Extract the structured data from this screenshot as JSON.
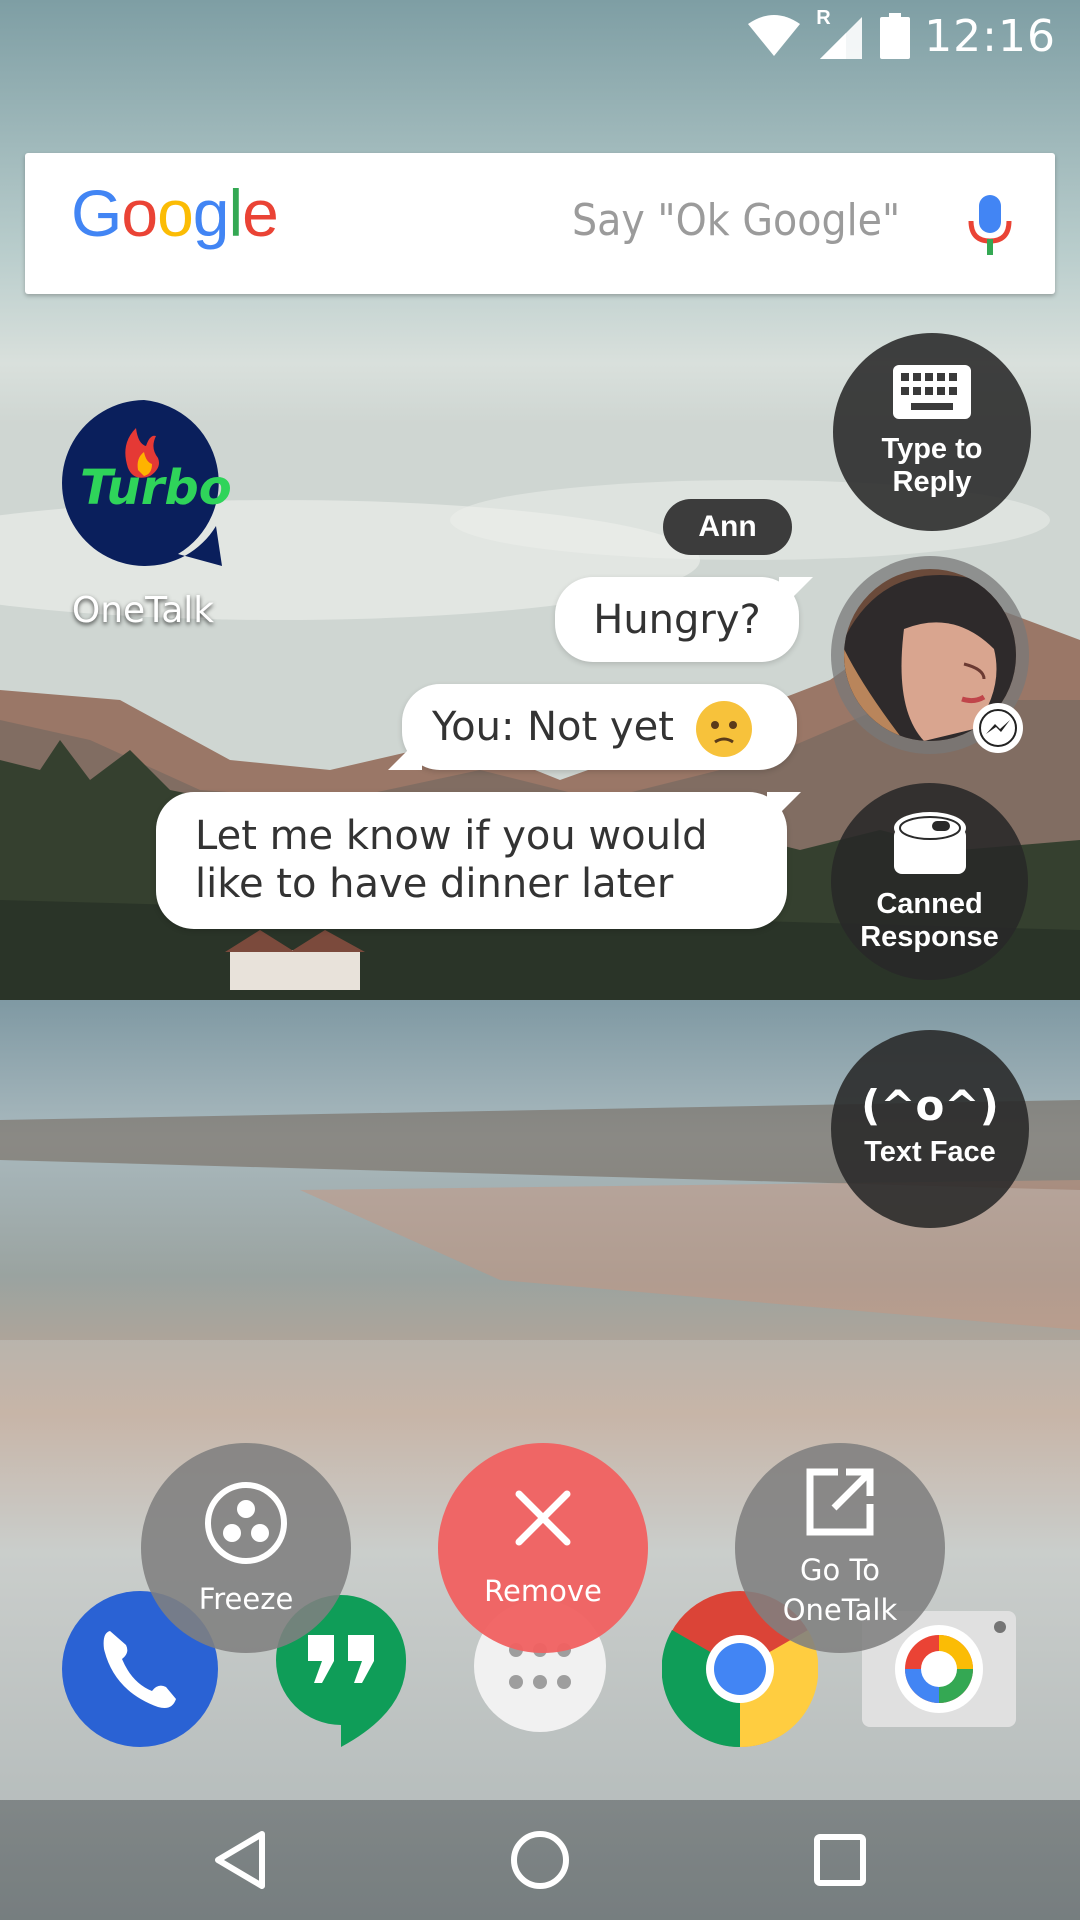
{
  "status_bar": {
    "time": "12:16",
    "roaming": "R",
    "icons": [
      "wifi-icon",
      "cell-signal-icon",
      "battery-icon"
    ]
  },
  "search": {
    "logo_letters": [
      "G",
      "o",
      "o",
      "g",
      "l",
      "e"
    ],
    "logo_colors": [
      "#4285F4",
      "#EA4335",
      "#FBBC05",
      "#4285F4",
      "#34A853",
      "#EA4335"
    ],
    "hint": "Say \"Ok Google\""
  },
  "home_app": {
    "icon_text": "Turbo",
    "label": "OneTalk"
  },
  "chat": {
    "sender": "Ann",
    "messages": [
      "Hungry?",
      "You: Not yet",
      "Let me know if you would like to have dinner later"
    ]
  },
  "quick_actions": {
    "type_to_reply": "Type to Reply",
    "canned_response": "Canned Response",
    "text_face_glyph": "(^o^)",
    "text_face": "Text Face"
  },
  "bubble_actions": {
    "freeze": "Freeze",
    "remove": "Remove",
    "go_to": "Go To OneTalk"
  },
  "dock": [
    "phone-icon",
    "hangouts-icon",
    "app-drawer-icon",
    "chrome-icon",
    "camera-icon"
  ],
  "nav": [
    "back-icon",
    "home-icon",
    "recents-icon"
  ],
  "colors": {
    "remove": "#F06262",
    "action_gray": "#808080",
    "fab_dark": "#282828",
    "turbo_blue": "#0A1F5C",
    "turbo_green": "#2FD45A"
  }
}
